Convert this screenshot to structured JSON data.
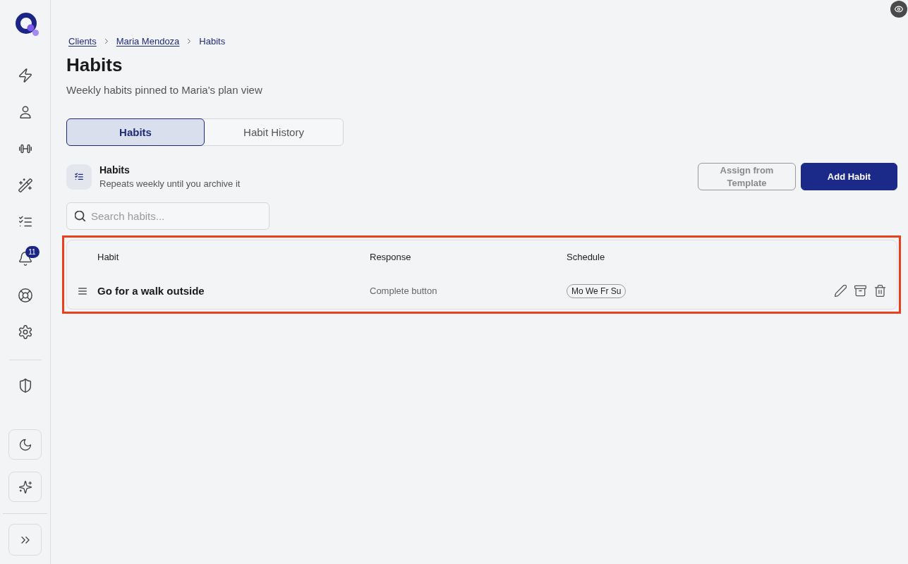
{
  "sidebar": {
    "notification_badge": "11"
  },
  "breadcrumb": [
    {
      "label": "Clients",
      "link": true
    },
    {
      "label": "Maria Mendoza",
      "link": true
    },
    {
      "label": "Habits",
      "link": false
    }
  ],
  "page": {
    "title": "Habits",
    "subtitle": "Weekly habits pinned to Maria's plan view"
  },
  "tabs": [
    {
      "label": "Habits",
      "selected": true
    },
    {
      "label": "Habit History",
      "selected": false
    }
  ],
  "section": {
    "title": "Habits",
    "subtitle": "Repeats weekly until you archive it"
  },
  "buttons": [
    {
      "label": "Assign from Template",
      "kind": "outline",
      "disabled": true
    },
    {
      "label": "Add Habit",
      "kind": "primary",
      "disabled": false
    }
  ],
  "search": {
    "placeholder": "Search habits..."
  },
  "table": {
    "highlighted": true,
    "columns": [
      "Habit",
      "Response",
      "Schedule"
    ],
    "rows": [
      {
        "habit": "Go for a walk outside",
        "response": "Complete button",
        "schedule": "Mo We Fr Su"
      }
    ]
  }
}
